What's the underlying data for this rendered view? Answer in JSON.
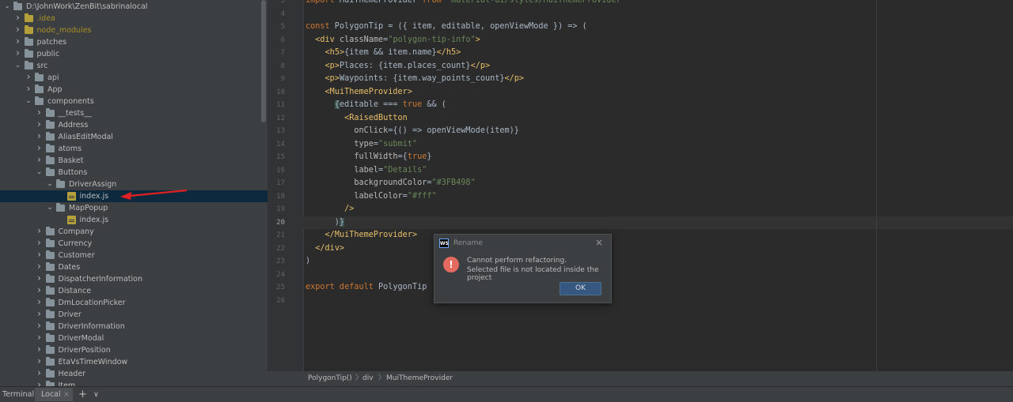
{
  "project_tree": {
    "rows": [
      {
        "label": "D:\\JohnWork\\ZenBit\\sabrinalocal",
        "indent": 0,
        "type": "folder",
        "open": true,
        "style": "normal"
      },
      {
        "label": ".idea",
        "indent": 1,
        "type": "folder",
        "open": false,
        "style": "nm"
      },
      {
        "label": "node_modules",
        "indent": 1,
        "type": "folder",
        "open": false,
        "style": "nm"
      },
      {
        "label": "patches",
        "indent": 1,
        "type": "folder",
        "open": false,
        "style": "normal"
      },
      {
        "label": "public",
        "indent": 1,
        "type": "folder",
        "open": false,
        "style": "normal"
      },
      {
        "label": "src",
        "indent": 1,
        "type": "folder",
        "open": true,
        "style": "normal"
      },
      {
        "label": "api",
        "indent": 2,
        "type": "folder",
        "open": false,
        "style": "normal"
      },
      {
        "label": "App",
        "indent": 2,
        "type": "folder",
        "open": false,
        "style": "normal"
      },
      {
        "label": "components",
        "indent": 2,
        "type": "folder",
        "open": true,
        "style": "normal"
      },
      {
        "label": "__tests__",
        "indent": 3,
        "type": "folder",
        "open": false,
        "style": "normal"
      },
      {
        "label": "Address",
        "indent": 3,
        "type": "folder",
        "open": false,
        "style": "normal"
      },
      {
        "label": "AliasEditModal",
        "indent": 3,
        "type": "folder",
        "open": false,
        "style": "normal"
      },
      {
        "label": "atoms",
        "indent": 3,
        "type": "folder",
        "open": false,
        "style": "normal"
      },
      {
        "label": "Basket",
        "indent": 3,
        "type": "folder",
        "open": false,
        "style": "normal"
      },
      {
        "label": "Buttons",
        "indent": 3,
        "type": "folder",
        "open": true,
        "style": "normal"
      },
      {
        "label": "DriverAssign",
        "indent": 4,
        "type": "folder",
        "open": true,
        "style": "normal"
      },
      {
        "label": "index.js",
        "indent": 5,
        "type": "file",
        "open": false,
        "style": "selected"
      },
      {
        "label": "MapPopup",
        "indent": 4,
        "type": "folder",
        "open": true,
        "style": "normal"
      },
      {
        "label": "index.js",
        "indent": 5,
        "type": "file",
        "open": false,
        "style": "normal"
      },
      {
        "label": "Company",
        "indent": 3,
        "type": "folder",
        "open": false,
        "style": "normal"
      },
      {
        "label": "Currency",
        "indent": 3,
        "type": "folder",
        "open": false,
        "style": "normal"
      },
      {
        "label": "Customer",
        "indent": 3,
        "type": "folder",
        "open": false,
        "style": "normal"
      },
      {
        "label": "Dates",
        "indent": 3,
        "type": "folder",
        "open": false,
        "style": "normal"
      },
      {
        "label": "DispatcherInformation",
        "indent": 3,
        "type": "folder",
        "open": false,
        "style": "normal"
      },
      {
        "label": "Distance",
        "indent": 3,
        "type": "folder",
        "open": false,
        "style": "normal"
      },
      {
        "label": "DmLocationPicker",
        "indent": 3,
        "type": "folder",
        "open": false,
        "style": "normal"
      },
      {
        "label": "Driver",
        "indent": 3,
        "type": "folder",
        "open": false,
        "style": "normal"
      },
      {
        "label": "DriverInformation",
        "indent": 3,
        "type": "folder",
        "open": false,
        "style": "normal"
      },
      {
        "label": "DriverModal",
        "indent": 3,
        "type": "folder",
        "open": false,
        "style": "normal"
      },
      {
        "label": "DriverPosition",
        "indent": 3,
        "type": "folder",
        "open": false,
        "style": "normal"
      },
      {
        "label": "EtaVsTimeWindow",
        "indent": 3,
        "type": "folder",
        "open": false,
        "style": "normal"
      },
      {
        "label": "Header",
        "indent": 3,
        "type": "folder",
        "open": false,
        "style": "normal"
      },
      {
        "label": "Item",
        "indent": 3,
        "type": "folder",
        "open": false,
        "style": "normal"
      }
    ]
  },
  "editor": {
    "current_line": 20,
    "lines": [
      {
        "n": "3",
        "html": "<span class=\"k\">import</span> MuiThemeProvider <span class=\"k\">from</span> <span class=\"s\">'material-ui/styles/MuiThemeProvider'</span>"
      },
      {
        "n": "4",
        "html": ""
      },
      {
        "n": "5",
        "html": "<span class=\"k\">const</span> PolygonTip = ({ item, editable, openViewMode }) => ("
      },
      {
        "n": "6",
        "html": "  <span class=\"tag\">&lt;div</span> <span class=\"a\">className</span>=<span class=\"s\">\"polygon-tip-info\"</span><span class=\"tag\">&gt;</span>"
      },
      {
        "n": "7",
        "html": "    <span class=\"tag\">&lt;h5&gt;</span>{item && item.name}<span class=\"tag\">&lt;/h5&gt;</span>"
      },
      {
        "n": "8",
        "html": "    <span class=\"tag\">&lt;p&gt;</span>Places: {item.places_count}<span class=\"tag\">&lt;/p&gt;</span>"
      },
      {
        "n": "9",
        "html": "    <span class=\"tag\">&lt;p&gt;</span>Waypoints: {item.way_points_count}<span class=\"tag\">&lt;/p&gt;</span>"
      },
      {
        "n": "10",
        "html": "    <span class=\"tag\">&lt;MuiThemeProvider&gt;</span>"
      },
      {
        "n": "11",
        "html": "      <span class=\"hl\">{</span>editable === <span class=\"k\">true</span> && ("
      },
      {
        "n": "12",
        "html": "        <span class=\"tag\">&lt;RaisedButton</span>"
      },
      {
        "n": "13",
        "html": "          <span class=\"a\">onClick</span>={() => openViewMode(item)}"
      },
      {
        "n": "14",
        "html": "          <span class=\"a\">type</span>=<span class=\"s\">\"submit\"</span>"
      },
      {
        "n": "15",
        "html": "          <span class=\"a\">fullWidth</span>={<span class=\"k\">true</span>}"
      },
      {
        "n": "16",
        "html": "          <span class=\"a\">label</span>=<span class=\"s\">\"Details\"</span>"
      },
      {
        "n": "17",
        "html": "          <span class=\"a\">backgroundColor</span>=<span class=\"s\">\"#3FB498\"</span>"
      },
      {
        "n": "18",
        "html": "          <span class=\"a\">labelColor</span>=<span class=\"s\">\"#fff\"</span>"
      },
      {
        "n": "19",
        "html": "        <span class=\"tag\">/&gt;</span>"
      },
      {
        "n": "20",
        "html": "      )<span class=\"hl\">}</span>"
      },
      {
        "n": "21",
        "html": "    <span class=\"tag\">&lt;/MuiThemeProvider&gt;</span>"
      },
      {
        "n": "22",
        "html": "  <span class=\"tag\">&lt;/div&gt;</span>"
      },
      {
        "n": "23",
        "html": ")"
      },
      {
        "n": "24",
        "html": ""
      },
      {
        "n": "25",
        "html": "<span class=\"k\">export default</span> PolygonTip"
      },
      {
        "n": "26",
        "html": ""
      }
    ]
  },
  "breadcrumb": {
    "items": [
      "PolygonTip()",
      "div",
      "MuiThemeProvider"
    ]
  },
  "terminal": {
    "label": "Terminal:",
    "tab": "Local",
    "close": "×",
    "add": "+",
    "dropdown": "∨"
  },
  "dialog": {
    "app_icon": "WS",
    "title": "Rename",
    "close": "×",
    "message_line1": "Cannot perform refactoring.",
    "message_line2": "Selected file is not located inside the project",
    "ok_label": "OK",
    "error_glyph": "!"
  },
  "colors": {
    "tree_bg": "#3c3f41",
    "editor_bg": "#2b2b2b",
    "selection": "#0d293e",
    "keyword": "#cc7832",
    "tag": "#e8bf6a",
    "string": "#6a8759",
    "error": "#e46a5f",
    "ok_button": "#365880",
    "annotation_arrow": "#e02020"
  }
}
